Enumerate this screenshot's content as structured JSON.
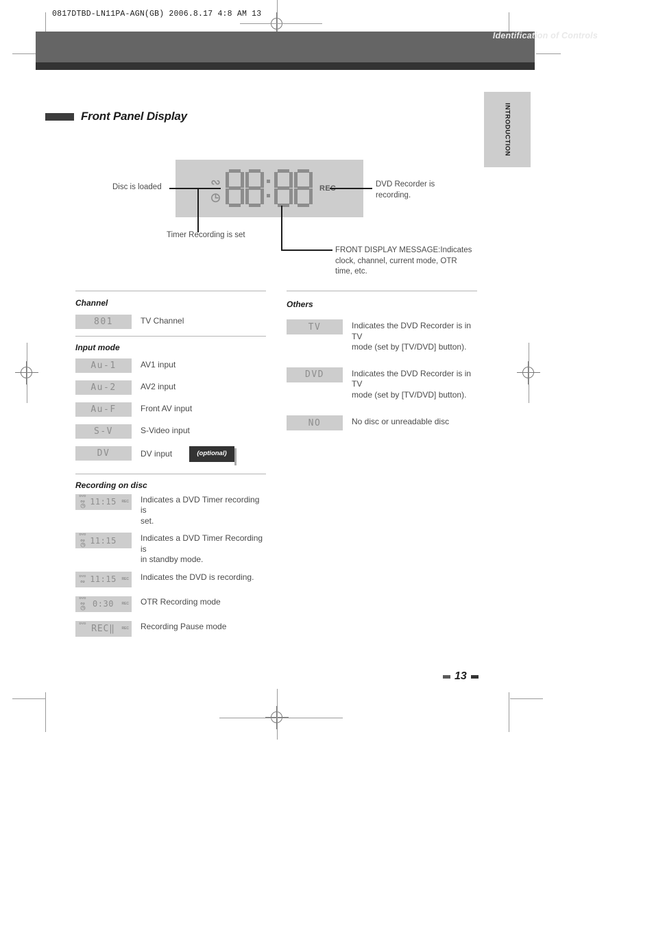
{
  "print_slug": "0817DTBD-LN11PA-AGN(GB)  2006.8.17 4:8 AM    13",
  "header": {
    "title": "Identification of Controls",
    "side_tab": "INTRODUCTION"
  },
  "section": {
    "title": "Front Panel Display"
  },
  "diagram": {
    "display_digits": "88:88",
    "rec_indicator": "REC",
    "callouts": {
      "disc_loaded": "Disc is loaded",
      "timer_set": "Timer Recording is set",
      "recording": "DVD Recorder is\nrecording.",
      "front_message": "FRONT DISPLAY MESSAGE:Indicates clock, channel, current mode, OTR time, etc."
    },
    "callout_recording_line1": "DVD Recorder is",
    "callout_recording_line2": "recording.",
    "callout_message_line1": "FRONT DISPLAY MESSAGE:Indicates",
    "callout_message_line2": "clock, channel, current mode, OTR",
    "callout_message_line3": "time, etc."
  },
  "groups": {
    "channel": {
      "title": "Channel",
      "rows": [
        {
          "code": "801",
          "desc": "TV Channel"
        }
      ]
    },
    "input_mode": {
      "title": "Input mode",
      "rows": [
        {
          "code": "Au-1",
          "desc": "AV1 input"
        },
        {
          "code": "Au-2",
          "desc": "AV2 input"
        },
        {
          "code": "Au-F",
          "desc": "Front AV input"
        },
        {
          "code": "S-V",
          "desc": "S-Video input"
        },
        {
          "code": "DV",
          "desc": "DV input",
          "badge": "(optional)"
        }
      ]
    },
    "recording_on_disc": {
      "title": "Recording on disc",
      "rows": [
        {
          "dvd": "DVD",
          "disc": true,
          "clock": true,
          "time": "11:15",
          "rec": "REC",
          "desc_line1": "Indicates a DVD Timer recording is",
          "desc_line2": "set."
        },
        {
          "dvd": "DVD",
          "disc": true,
          "clock": true,
          "time": "11:15",
          "rec": "",
          "desc_line1": "Indicates a DVD Timer Recording is",
          "desc_line2": "in standby mode."
        },
        {
          "dvd": "DVD",
          "disc": true,
          "clock": false,
          "time": "11:15",
          "rec": "REC",
          "desc_line1": "Indicates the DVD is recording.",
          "desc_line2": ""
        },
        {
          "dvd": "DVD",
          "disc": true,
          "clock": true,
          "time": "0:30",
          "rec": "REC",
          "desc_line1": "OTR Recording mode",
          "desc_line2": ""
        },
        {
          "dvd": "DVD",
          "disc": false,
          "clock": false,
          "time": "REC‖",
          "rec": "REC",
          "desc_line1": "Recording Pause mode",
          "desc_line2": ""
        }
      ]
    },
    "others": {
      "title": "Others",
      "rows": [
        {
          "code": "TV",
          "desc_line1": "Indicates the DVD Recorder is in TV",
          "desc_line2": "mode (set by [TV/DVD] button)."
        },
        {
          "code": "DVD",
          "desc_line1": "Indicates the DVD Recorder is in TV",
          "desc_line2": "mode (set by [TV/DVD] button)."
        },
        {
          "code": "NO",
          "desc_line1": "No disc or unreadable disc",
          "desc_line2": ""
        }
      ]
    }
  },
  "footer": {
    "page_number": "13"
  },
  "colors": {
    "header_band": "#656565",
    "header_dark": "#333333",
    "chip_bg": "#cdcdcd",
    "lcd_fg": "#8d8d8d",
    "text": "#4a4a4a",
    "badge_bg": "#333333"
  }
}
